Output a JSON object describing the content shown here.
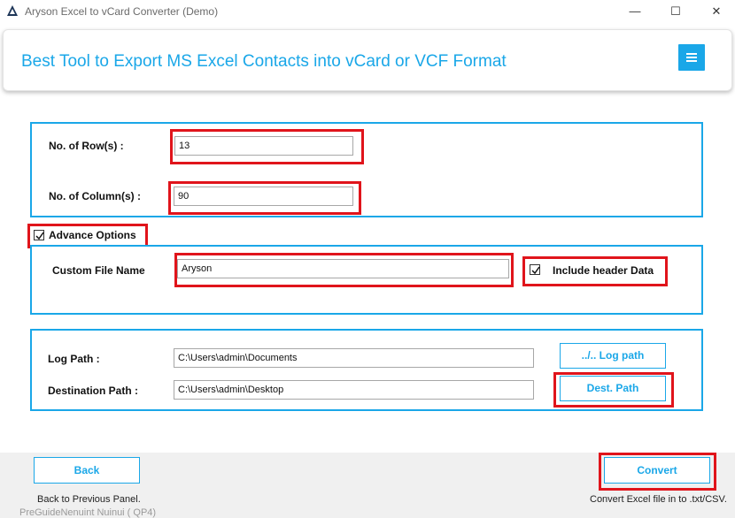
{
  "window": {
    "title": "Aryson Excel to vCard Converter (Demo)",
    "minimize_glyph": "—",
    "maximize_glyph": "☐",
    "close_glyph": "✕"
  },
  "header": {
    "title": "Best Tool to Export MS Excel Contacts into vCard or VCF Format",
    "menu_icon": "hamburger-icon"
  },
  "dimensions": {
    "rows_label": "No. of Row(s) :",
    "rows_value": "13",
    "columns_label": "No. of Column(s) :",
    "columns_value": "90"
  },
  "advance_options": {
    "label": "Advance Options",
    "checked": true,
    "custom_file_name_label": "Custom File Name",
    "custom_file_name_value": "Aryson",
    "include_header_label": "Include header Data",
    "include_header_checked": true
  },
  "paths": {
    "log_path_label": "Log Path :",
    "log_path_value": "C:\\Users\\admin\\Documents",
    "log_path_button": "../.. Log path",
    "dest_path_label": "Destination  Path :",
    "dest_path_value": "C:\\Users\\admin\\Desktop",
    "dest_path_button": "Dest. Path"
  },
  "footer": {
    "back_button": "Back",
    "back_caption": "Back to Previous Panel.",
    "convert_button": "Convert",
    "convert_caption": "Convert Excel file in to .txt/CSV.",
    "ghost_text": "PreGuideNenuint Nuinui ( QP4)"
  },
  "colors": {
    "accent": "#1aa7e8",
    "highlight": "#e0141b",
    "footer_bg": "#f0f0f0"
  }
}
